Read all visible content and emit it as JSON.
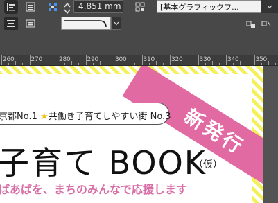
{
  "toolbar": {
    "measurement_value": "4.851 mm",
    "object_style_select": "[基本グラフィックフ..."
  },
  "ruler": {
    "ticks": [
      "260",
      "270",
      "280",
      "290",
      "300",
      "310",
      "320",
      "330",
      "340",
      "350"
    ]
  },
  "document": {
    "sash_label": "新発行",
    "tagline": "京都No.1 ",
    "tagline_star": "★",
    "tagline_rest": "共働き子育てしやすい街 No.3",
    "title": "子育て BOOK",
    "title_suffix": "（仮）",
    "subtitle": "ばあばを、まちのみんなで応援します"
  },
  "colors": {
    "sash": "#e26aa2",
    "stripe": "#f4f05a",
    "subtitle": "#d76ea6"
  }
}
